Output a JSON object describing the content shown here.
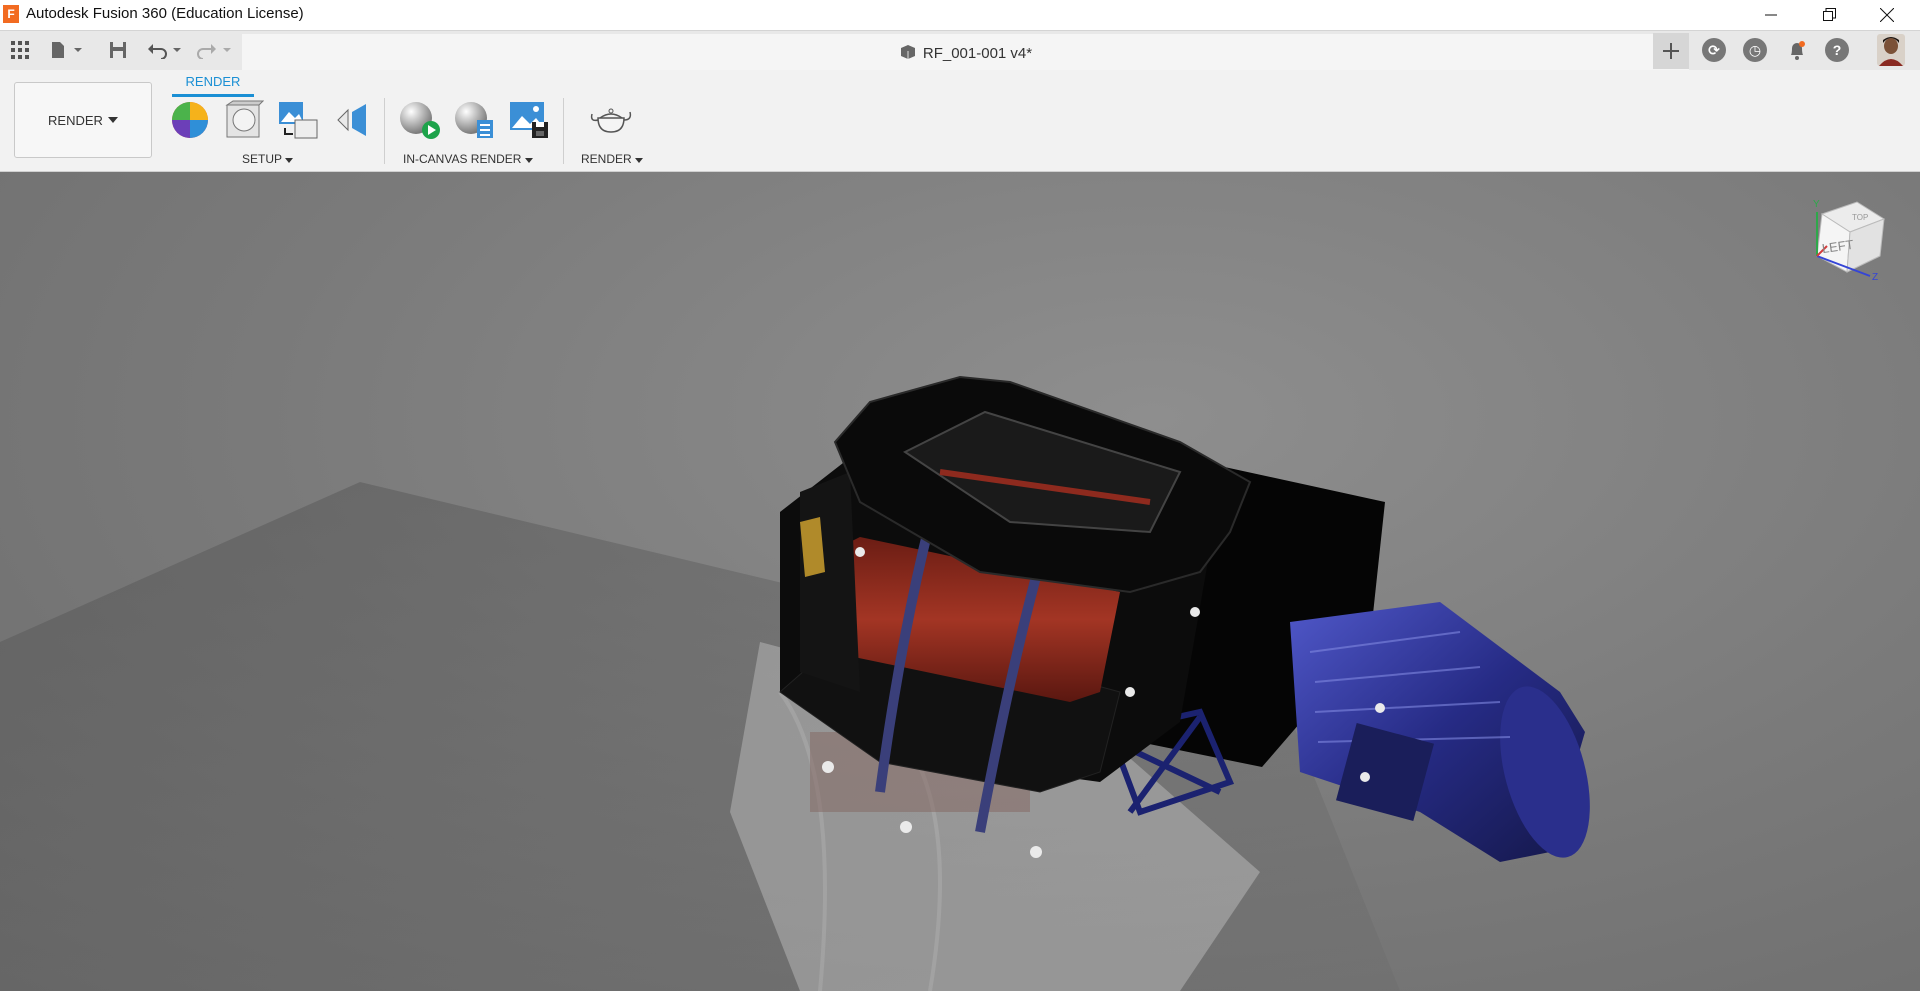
{
  "window": {
    "app_title": "Autodesk Fusion 360 (Education License)",
    "logo_letter": "F"
  },
  "tabs": {
    "document_title": "RF_001-001 v4*"
  },
  "toolbar": {
    "workspace_label": "RENDER",
    "active_tab": "RENDER",
    "groups": {
      "setup": "SETUP",
      "in_canvas_render": "IN-CANVAS RENDER",
      "render": "RENDER"
    }
  },
  "viewcube": {
    "face_label": "LEFT",
    "top_label": "TOP",
    "axis_y": "Y",
    "axis_z": "Z"
  },
  "colors": {
    "accent": "#1a8fd4",
    "logo": "#f26b21",
    "canvas": "#7a7a7a",
    "motor": "#2b2f8a",
    "rotor": "#8e2a1e"
  }
}
